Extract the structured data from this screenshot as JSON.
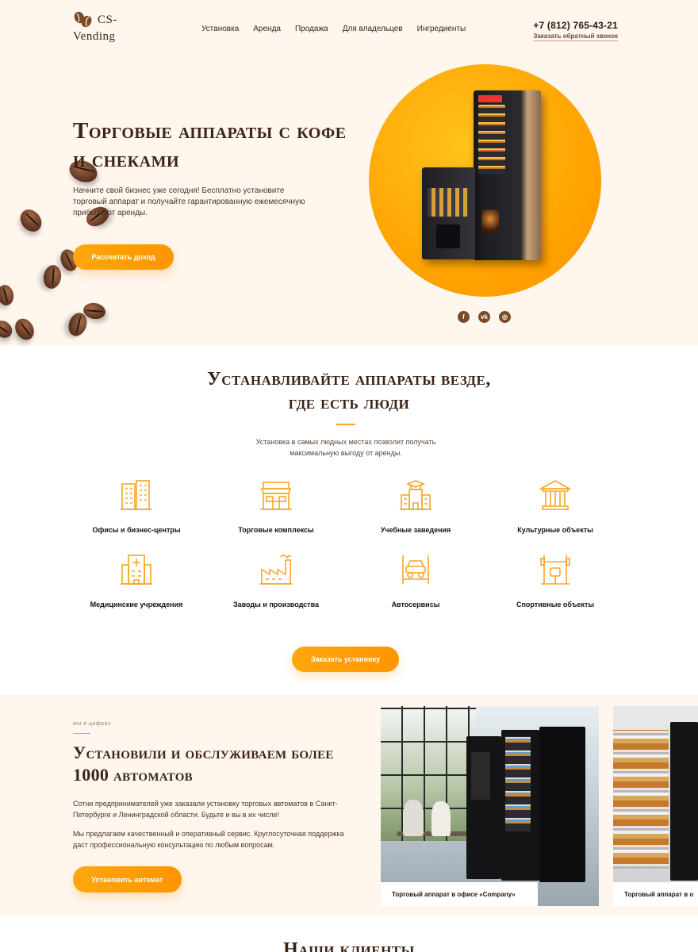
{
  "header": {
    "logo_line1": "CS-",
    "logo_line2": "Vending",
    "nav": [
      "Установка",
      "Аренда",
      "Продажа",
      "Для владельцев",
      "Ингредиенты"
    ],
    "phone": "+7 (812) 765-43-21",
    "callback": "Заказать обратный звонок"
  },
  "hero": {
    "title": "Торговые аппараты с кофе и снеками",
    "text": "Начните свой бизнес уже сегодня! Бесплатно установите торговый аппарат и получайте гарантированную ежемесячную прибыль от аренды.",
    "button": "Рассчитать доход",
    "socials": [
      {
        "icon": "facebook-icon",
        "glyph": "f"
      },
      {
        "icon": "vk-icon",
        "glyph": "vk"
      },
      {
        "icon": "instagram-icon",
        "glyph": "◎"
      }
    ]
  },
  "places": {
    "title_line1": "Устанавливайте аппараты везде,",
    "title_line2": "где есть люди",
    "subtitle": "Установка в самых людных местах позволит получать максимальную выгоду от аренды.",
    "items": [
      {
        "label": "Офисы и бизнес-центры",
        "icon": "office-buildings-icon"
      },
      {
        "label": "Торговые комплексы",
        "icon": "shopping-mall-icon"
      },
      {
        "label": "Учебные заведения",
        "icon": "school-icon"
      },
      {
        "label": "Культурные объекты",
        "icon": "museum-icon"
      },
      {
        "label": "Медицинские учреждения",
        "icon": "hospital-icon"
      },
      {
        "label": "Заводы и производства",
        "icon": "factory-icon"
      },
      {
        "label": "Автосервисы",
        "icon": "car-lift-icon"
      },
      {
        "label": "Спортивные объекты",
        "icon": "gym-icon"
      }
    ],
    "button": "Заказать установку"
  },
  "numbers": {
    "eyebrow": "мы в цифрах",
    "title": "Установили и обслуживаем более 1000 автоматов",
    "p1": "Сотни предпринимателей уже заказали установку торговых автоматов в Санкт-Петербурге и Ленинградской области. Будьте и вы в их числе!",
    "p2": "Мы предлагаем качественный и оперативный сервис. Круглосуточная поддержка даст профессиональную консультацию по любым вопросам.",
    "button": "Установить автомат",
    "photos": [
      {
        "caption": "Торговый аппарат в офисе «Company»"
      },
      {
        "caption": "Торговый аппарат в о"
      }
    ]
  },
  "clients": {
    "title": "Наши клиенты"
  },
  "colors": {
    "accent": "#ff9d00",
    "brown": "#3a2418",
    "background": "#fff6ee"
  }
}
